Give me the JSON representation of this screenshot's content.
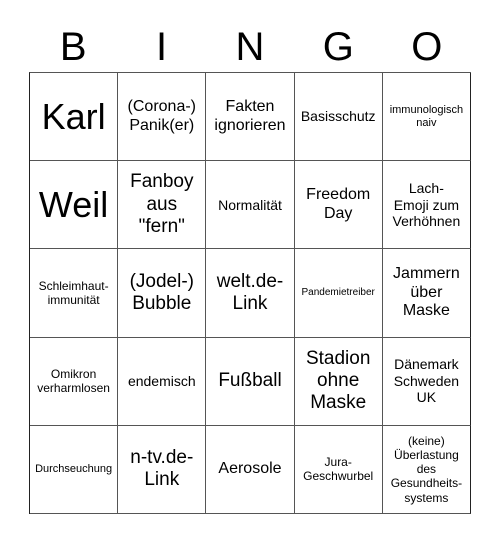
{
  "header": {
    "letters": [
      "B",
      "I",
      "N",
      "G",
      "O"
    ]
  },
  "grid": {
    "rows": [
      [
        {
          "text": "Karl",
          "size": "xxl"
        },
        {
          "text": "(Corona-)\nPanik(er)",
          "size": "l"
        },
        {
          "text": "Fakten\nignorieren",
          "size": "l"
        },
        {
          "text": "Basisschutz",
          "size": "m"
        },
        {
          "text": "immunologisch\nnaiv",
          "size": "xs"
        }
      ],
      [
        {
          "text": "Weil",
          "size": "xxl"
        },
        {
          "text": "Fanboy\naus\n\"fern\"",
          "size": "xl"
        },
        {
          "text": "Normalität",
          "size": "m"
        },
        {
          "text": "Freedom\nDay",
          "size": "l"
        },
        {
          "text": "Lach-\nEmoji zum\nVerhöhnen",
          "size": "m"
        }
      ],
      [
        {
          "text": "Schleimhaut-\nimmunität",
          "size": "s"
        },
        {
          "text": "(Jodel-)\nBubble",
          "size": "xl"
        },
        {
          "text": "welt.de-\nLink",
          "size": "xl"
        },
        {
          "text": "Pandemietreiber",
          "size": "xxs"
        },
        {
          "text": "Jammern\nüber\nMaske",
          "size": "l"
        }
      ],
      [
        {
          "text": "Omikron\nverharmlosen",
          "size": "s"
        },
        {
          "text": "endemisch",
          "size": "m"
        },
        {
          "text": "Fußball",
          "size": "xl"
        },
        {
          "text": "Stadion\nohne\nMaske",
          "size": "xl"
        },
        {
          "text": "Dänemark\nSchweden\nUK",
          "size": "m"
        }
      ],
      [
        {
          "text": "Durchseuchung",
          "size": "xs"
        },
        {
          "text": "n-tv.de-\nLink",
          "size": "xl"
        },
        {
          "text": "Aerosole",
          "size": "l"
        },
        {
          "text": "Jura-\nGeschwurbel",
          "size": "s"
        },
        {
          "text": "(keine)\nÜberlastung\ndes\nGesundheits-\nsystems",
          "size": "s"
        }
      ]
    ]
  }
}
